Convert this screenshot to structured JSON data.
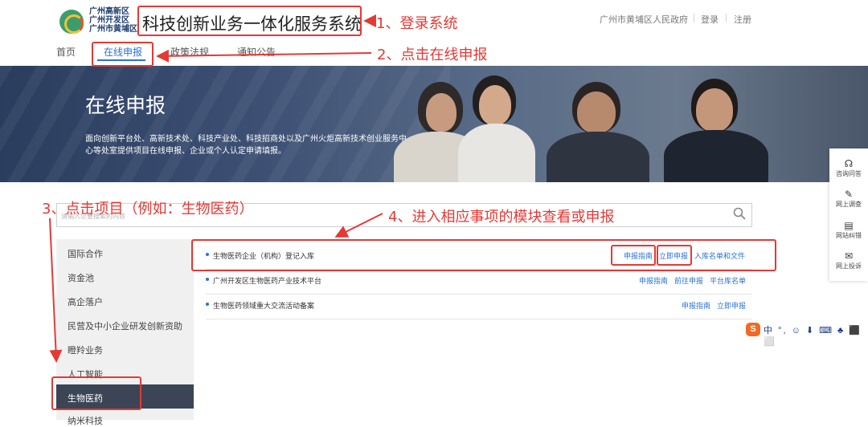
{
  "header": {
    "logo_lines": [
      "广州高新区",
      "广州开发区",
      "广州市黄埔区"
    ],
    "system_title": "科技创新业务一体化服务系统",
    "gov_link": "广州市黄埔区人民政府",
    "login": "登录",
    "register": "注册"
  },
  "nav": [
    "首页",
    "在线申报",
    "政策法规",
    "通知公告"
  ],
  "banner": {
    "title": "在线申报",
    "desc": "面向创新平台处、高新技术处、科技产业处、科技招商处以及广州火炬高新技术创业服务中心等处室提供项目在线申报、企业或个人认定申请填报。"
  },
  "side_services": [
    "咨询问答",
    "网上调查",
    "网站纠错",
    "网上投诉"
  ],
  "search": {
    "placeholder": "请输入您要搜索的内容"
  },
  "categories": [
    "国际合作",
    "资金池",
    "高企落户",
    "民营及中小企业研发创新资助",
    "瞪羚业务",
    "人工智能",
    "生物医药",
    "纳米科技"
  ],
  "items": [
    {
      "title": "生物医药企业（机构）登记入库",
      "links": [
        "申报指南",
        "立即申报",
        "入库名单和文件"
      ]
    },
    {
      "title": "广州开发区生物医药产业技术平台",
      "links": [
        "申报指南",
        "前往申报",
        "平台库名单"
      ]
    },
    {
      "title": "生物医药领域重大交流活动备案",
      "links": [
        "申报指南",
        "立即申报"
      ]
    }
  ],
  "annotations": {
    "step1": "1、登录系统",
    "step2": "2、点击在线申报",
    "step3": "3、点击项目（例如：生物医药）",
    "step4": "4、进入相应事项的模块查看或申报"
  },
  "ime": {
    "logo": "S",
    "text": "中 °, ☺ ⬇ ⌨ ♣ ⬛ ⬜"
  },
  "colors": {
    "accent": "#2b72d6",
    "annotation": "#e53935",
    "sidebar_active": "#3b4556"
  }
}
